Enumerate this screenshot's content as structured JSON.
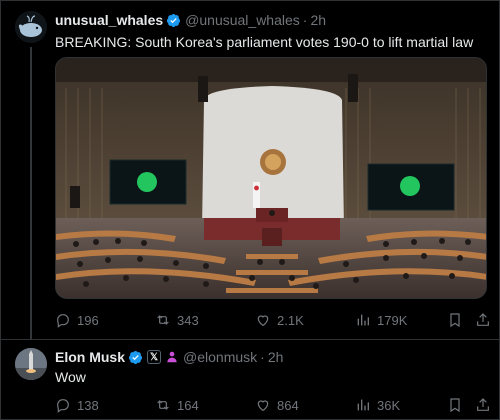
{
  "tweet1": {
    "display_name": "unusual_whales",
    "handle": "@unusual_whales",
    "separator": "·",
    "time": "2h",
    "text": "BREAKING: South Korea's parliament votes 190-0 to lift martial law",
    "stats": {
      "replies": "196",
      "reposts": "343",
      "likes": "2.1K",
      "views": "179K"
    }
  },
  "tweet2": {
    "display_name": "Elon Musk",
    "handle": "@elonmusk",
    "separator": "·",
    "time": "2h",
    "text": "Wow",
    "stats": {
      "replies": "138",
      "reposts": "164",
      "likes": "864",
      "views": "36K"
    }
  },
  "colors": {
    "verified": "#1d9bf0",
    "muted": "#71767b",
    "text": "#e7e9ea",
    "background": "#000000",
    "border": "#2f3336",
    "screen_green": "#22c55e"
  },
  "icons": [
    "verified-badge-icon",
    "reply-icon",
    "repost-icon",
    "like-icon",
    "views-icon",
    "bookmark-icon",
    "share-icon",
    "x-affiliate-icon",
    "person-badge-icon"
  ]
}
